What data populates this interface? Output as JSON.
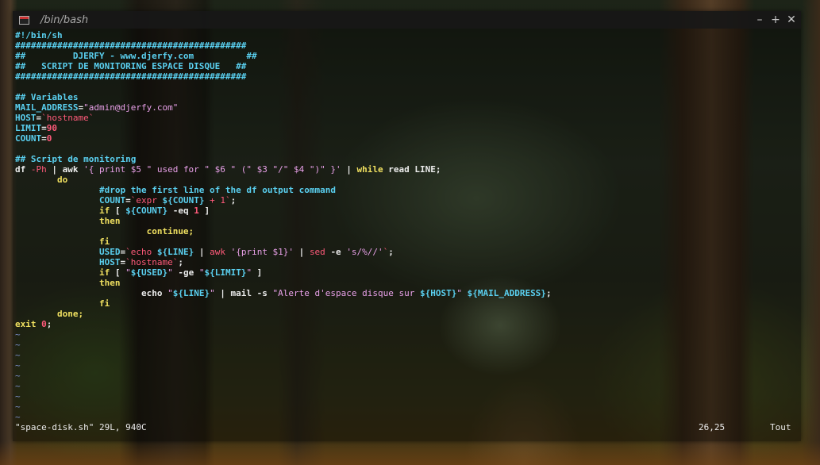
{
  "window": {
    "title": "/bin/bash",
    "buttons": {
      "minimize": "–",
      "maximize": "+",
      "close": "✕"
    }
  },
  "editor": {
    "lines": [
      [
        {
          "t": "#!/bin/sh",
          "c": "cm"
        }
      ],
      [
        {
          "t": "############################################",
          "c": "cm"
        }
      ],
      [
        {
          "t": "##         DJERFY - www.djerfy.com          ##",
          "c": "cm"
        }
      ],
      [
        {
          "t": "##   SCRIPT DE MONITORING ESPACE DISQUE   ##",
          "c": "cm"
        }
      ],
      [
        {
          "t": "############################################",
          "c": "cm"
        }
      ],
      [
        {
          "t": "",
          "c": "txt"
        }
      ],
      [
        {
          "t": "## Variables",
          "c": "cm"
        }
      ],
      [
        {
          "t": "MAIL_ADDRESS",
          "c": "var"
        },
        {
          "t": "=",
          "c": "txt"
        },
        {
          "t": "\"admin@djerfy.com\"",
          "c": "str"
        }
      ],
      [
        {
          "t": "HOST",
          "c": "var"
        },
        {
          "t": "=",
          "c": "txt"
        },
        {
          "t": "`hostname`",
          "c": "cmd"
        }
      ],
      [
        {
          "t": "LIMIT",
          "c": "var"
        },
        {
          "t": "=",
          "c": "txt"
        },
        {
          "t": "90",
          "c": "num"
        }
      ],
      [
        {
          "t": "COUNT",
          "c": "var"
        },
        {
          "t": "=",
          "c": "txt"
        },
        {
          "t": "0",
          "c": "num"
        }
      ],
      [
        {
          "t": "",
          "c": "txt"
        }
      ],
      [
        {
          "t": "## Script de monitoring",
          "c": "cm"
        }
      ],
      [
        {
          "t": "df ",
          "c": "txt"
        },
        {
          "t": "-Ph",
          "c": "cmd"
        },
        {
          "t": " | awk ",
          "c": "txt"
        },
        {
          "t": "'{ print $5 \" used for \" $6 \" (\" $3 \"/\" $4 \")\" }'",
          "c": "str"
        },
        {
          "t": " | ",
          "c": "txt"
        },
        {
          "t": "while",
          "c": "kw"
        },
        {
          "t": " read LINE;",
          "c": "txt"
        }
      ],
      [
        {
          "t": "        ",
          "c": "txt"
        },
        {
          "t": "do",
          "c": "kw"
        }
      ],
      [
        {
          "t": "                ",
          "c": "txt"
        },
        {
          "t": "#drop the first line of the df output command",
          "c": "cm"
        }
      ],
      [
        {
          "t": "                ",
          "c": "txt"
        },
        {
          "t": "COUNT",
          "c": "var"
        },
        {
          "t": "=",
          "c": "txt"
        },
        {
          "t": "`expr ",
          "c": "cmd"
        },
        {
          "t": "${COUNT}",
          "c": "var"
        },
        {
          "t": " + 1`",
          "c": "cmd"
        },
        {
          "t": ";",
          "c": "txt"
        }
      ],
      [
        {
          "t": "                ",
          "c": "txt"
        },
        {
          "t": "if",
          "c": "kw"
        },
        {
          "t": " [ ",
          "c": "txt"
        },
        {
          "t": "${COUNT}",
          "c": "var"
        },
        {
          "t": " -eq ",
          "c": "txt"
        },
        {
          "t": "1",
          "c": "num"
        },
        {
          "t": " ]",
          "c": "txt"
        }
      ],
      [
        {
          "t": "                ",
          "c": "txt"
        },
        {
          "t": "then",
          "c": "kw"
        }
      ],
      [
        {
          "t": "                         ",
          "c": "txt"
        },
        {
          "t": "continue;",
          "c": "kw"
        }
      ],
      [
        {
          "t": "                ",
          "c": "txt"
        },
        {
          "t": "fi",
          "c": "kw"
        }
      ],
      [
        {
          "t": "                ",
          "c": "txt"
        },
        {
          "t": "USED",
          "c": "var"
        },
        {
          "t": "=",
          "c": "txt"
        },
        {
          "t": "`echo ",
          "c": "cmd"
        },
        {
          "t": "${LINE}",
          "c": "var"
        },
        {
          "t": " | ",
          "c": "txt"
        },
        {
          "t": "awk ",
          "c": "cmd"
        },
        {
          "t": "'{print $1}'",
          "c": "str"
        },
        {
          "t": " | ",
          "c": "txt"
        },
        {
          "t": "sed ",
          "c": "cmd"
        },
        {
          "t": "-e ",
          "c": "txt"
        },
        {
          "t": "'s/%//'",
          "c": "str"
        },
        {
          "t": "`",
          "c": "cmd"
        },
        {
          "t": ";",
          "c": "txt"
        }
      ],
      [
        {
          "t": "                ",
          "c": "txt"
        },
        {
          "t": "HOST",
          "c": "var"
        },
        {
          "t": "=",
          "c": "txt"
        },
        {
          "t": "`hostname`",
          "c": "cmd"
        },
        {
          "t": ";",
          "c": "txt"
        }
      ],
      [
        {
          "t": "                ",
          "c": "txt"
        },
        {
          "t": "if",
          "c": "kw"
        },
        {
          "t": " [ ",
          "c": "txt"
        },
        {
          "t": "\"",
          "c": "str"
        },
        {
          "t": "${USED}",
          "c": "var"
        },
        {
          "t": "\"",
          "c": "str"
        },
        {
          "t": " -ge ",
          "c": "txt"
        },
        {
          "t": "\"",
          "c": "str"
        },
        {
          "t": "${LIMIT}",
          "c": "var"
        },
        {
          "t": "\"",
          "c": "str"
        },
        {
          "t": " ]",
          "c": "txt"
        }
      ],
      [
        {
          "t": "                ",
          "c": "txt"
        },
        {
          "t": "then",
          "c": "kw"
        }
      ],
      [
        {
          "t": "                        ",
          "c": "txt"
        },
        {
          "t": "e",
          "c": "cursor"
        },
        {
          "t": "cho ",
          "c": "txt"
        },
        {
          "t": "\"",
          "c": "str"
        },
        {
          "t": "${LINE}",
          "c": "var"
        },
        {
          "t": "\"",
          "c": "str"
        },
        {
          "t": " | mail ",
          "c": "txt"
        },
        {
          "t": "-s ",
          "c": "txt"
        },
        {
          "t": "\"Alerte d'espace disque sur ",
          "c": "str"
        },
        {
          "t": "${HOST}",
          "c": "var"
        },
        {
          "t": "\"",
          "c": "str"
        },
        {
          "t": " ",
          "c": "txt"
        },
        {
          "t": "${MAIL_ADDRESS}",
          "c": "var"
        },
        {
          "t": ";",
          "c": "txt"
        }
      ],
      [
        {
          "t": "                ",
          "c": "txt"
        },
        {
          "t": "fi",
          "c": "kw"
        }
      ],
      [
        {
          "t": "        ",
          "c": "txt"
        },
        {
          "t": "done;",
          "c": "kw"
        }
      ],
      [
        {
          "t": "exit ",
          "c": "kw"
        },
        {
          "t": "0",
          "c": "num"
        },
        {
          "t": ";",
          "c": "txt"
        }
      ],
      [
        {
          "t": "~",
          "c": "tilde"
        }
      ],
      [
        {
          "t": "~",
          "c": "tilde"
        }
      ],
      [
        {
          "t": "~",
          "c": "tilde"
        }
      ],
      [
        {
          "t": "~",
          "c": "tilde"
        }
      ],
      [
        {
          "t": "~",
          "c": "tilde"
        }
      ],
      [
        {
          "t": "~",
          "c": "tilde"
        }
      ],
      [
        {
          "t": "~",
          "c": "tilde"
        }
      ],
      [
        {
          "t": "~",
          "c": "tilde"
        }
      ],
      [
        {
          "t": "~",
          "c": "tilde"
        }
      ]
    ]
  },
  "status": {
    "file_info": "\"space-disk.sh\" 29L, 940C",
    "cursor_position": "26,25",
    "scroll_position": "Tout"
  },
  "colors": {
    "comment": "#5ad0f0",
    "string": "#e8a0e8",
    "command": "#ff5a7a",
    "keyword": "#f0e060",
    "number": "#ff5a7a",
    "text": "#ececec"
  }
}
